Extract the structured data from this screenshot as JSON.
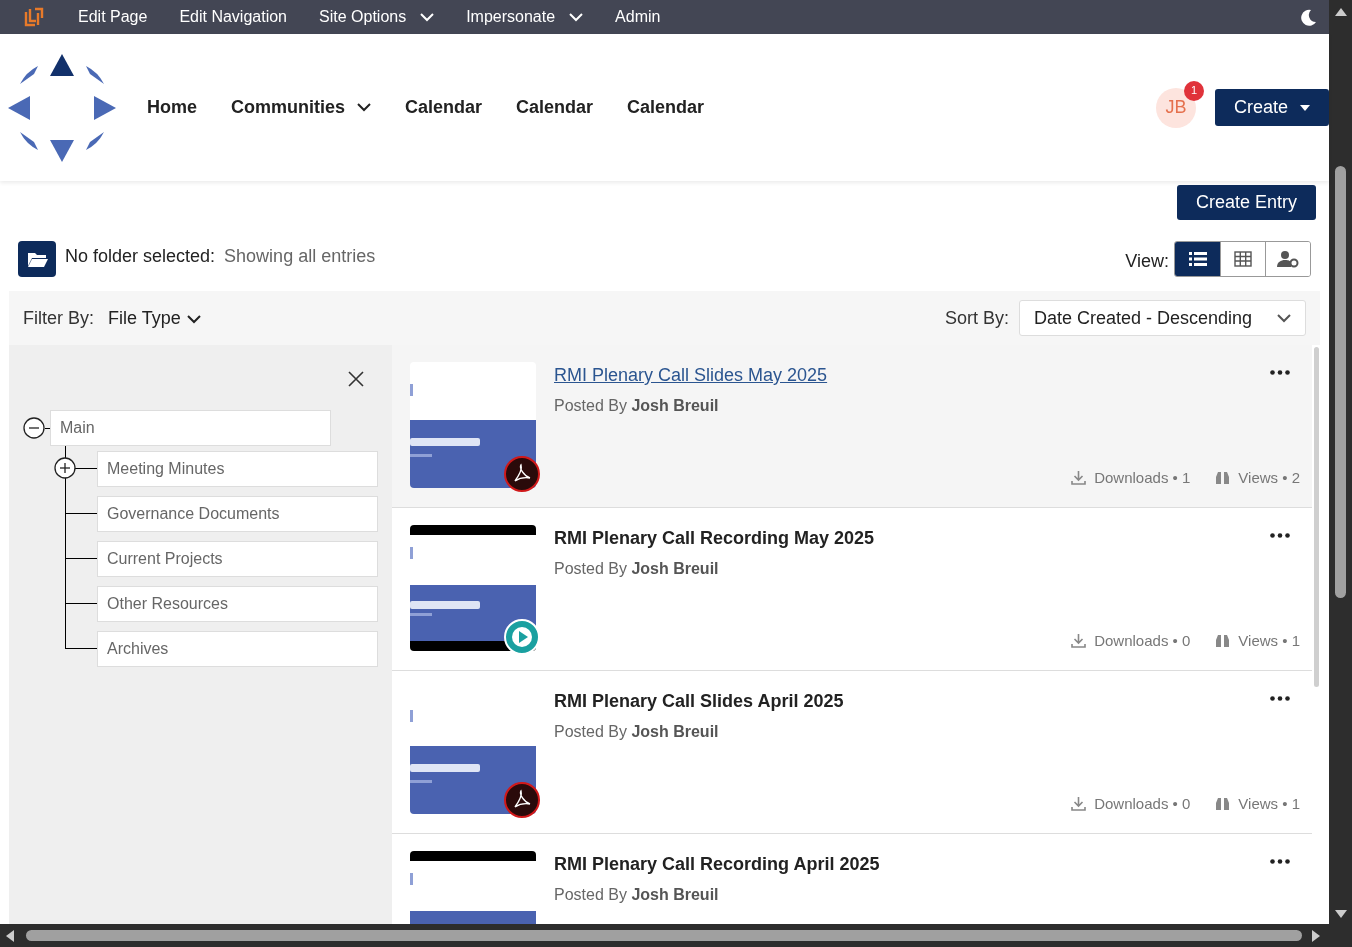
{
  "admin_bar": {
    "items": [
      {
        "label": "Edit Page",
        "dropdown": false
      },
      {
        "label": "Edit Navigation",
        "dropdown": false
      },
      {
        "label": "Site Options",
        "dropdown": true
      },
      {
        "label": "Impersonate",
        "dropdown": true
      },
      {
        "label": "Admin",
        "dropdown": false
      }
    ]
  },
  "nav": {
    "items": [
      {
        "label": "Home",
        "dropdown": false
      },
      {
        "label": "Communities",
        "dropdown": true
      },
      {
        "label": "Calendar",
        "dropdown": false
      },
      {
        "label": "Calendar",
        "dropdown": false
      },
      {
        "label": "Calendar",
        "dropdown": false
      }
    ],
    "avatar": {
      "initials": "JB",
      "badge": "1"
    },
    "create_button": "Create"
  },
  "create_entry_button": "Create Entry",
  "folder_status": {
    "label": "No folder selected:",
    "value": "Showing all entries"
  },
  "view": {
    "label": "View:",
    "options": [
      {
        "kind": "list",
        "selected": true
      },
      {
        "kind": "grid",
        "selected": false
      },
      {
        "kind": "user-settings",
        "selected": false
      }
    ]
  },
  "filter": {
    "label": "Filter By:",
    "value": "File Type"
  },
  "sort": {
    "label": "Sort By:",
    "value": "Date Created - Descending"
  },
  "tree": {
    "label": "Main",
    "expanded": true,
    "children": [
      {
        "label": "Meeting Minutes",
        "kind": "branch",
        "expanded": false
      },
      {
        "label": "Governance Documents",
        "kind": "leaf"
      },
      {
        "label": "Current Projects",
        "kind": "leaf"
      },
      {
        "label": "Other Resources",
        "kind": "leaf"
      },
      {
        "label": "Archives",
        "kind": "leaf"
      }
    ]
  },
  "entries": [
    {
      "title": "RMI Plenary Call Slides May 2025",
      "kind": "pdf",
      "selected": true,
      "posted_label": "Posted By",
      "author": "Josh Breuil",
      "downloads": "Downloads • 1",
      "views": "Views • 2"
    },
    {
      "title": "RMI Plenary Call Recording May 2025",
      "kind": "video",
      "selected": false,
      "posted_label": "Posted By",
      "author": "Josh Breuil",
      "downloads": "Downloads • 0",
      "views": "Views • 1"
    },
    {
      "title": "RMI Plenary Call Slides April 2025",
      "kind": "pdf",
      "selected": false,
      "posted_label": "Posted By",
      "author": "Josh Breuil",
      "downloads": "Downloads • 0",
      "views": "Views • 1"
    },
    {
      "title": "RMI Plenary Call Recording April 2025",
      "kind": "video",
      "selected": false,
      "posted_label": "Posted By",
      "author": "Josh Breuil"
    }
  ]
}
